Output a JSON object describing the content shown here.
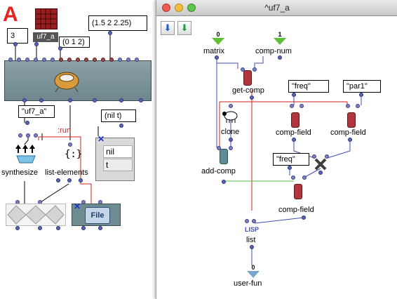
{
  "patch": {
    "letter_a": "A",
    "uf7_label": "uf7_a",
    "box_3": "3",
    "box_list012": "(0 1 2)",
    "box_list15": "(1.5 2 2.25)",
    "box_uf7": "\"uf7_a\"",
    "run_label": ":run",
    "synthesize": "synthesize",
    "list_elements": "list-elements",
    "box_nilt": "(nil t)",
    "list_items": [
      "nil",
      "t"
    ],
    "file_label": "File"
  },
  "window": {
    "title": "^uf7_a",
    "nodes": {
      "matrix": "matrix",
      "comp_num": "comp-num",
      "get_comp": "get-comp",
      "freq1": "\"freq\"",
      "par1": "\"par1\"",
      "clone": "clone",
      "comp_field1": "comp-field",
      "comp_field2": "comp-field",
      "freq2": "\"freq\"",
      "add_comp": "add-comp",
      "comp_field3": "comp-field",
      "lisp": "LISP",
      "list": "list",
      "user_fun": "user-fun"
    },
    "inputs": [
      {
        "index": "0"
      },
      {
        "index": "1"
      }
    ],
    "output_index": "0"
  },
  "colors": {
    "red_line": "#d21f1f",
    "blue_line": "#3e4fb0",
    "green_line": "#4cbf3f",
    "title_close": "#ee5a52",
    "title_min": "#f4bd3f",
    "title_max": "#5fc650"
  }
}
